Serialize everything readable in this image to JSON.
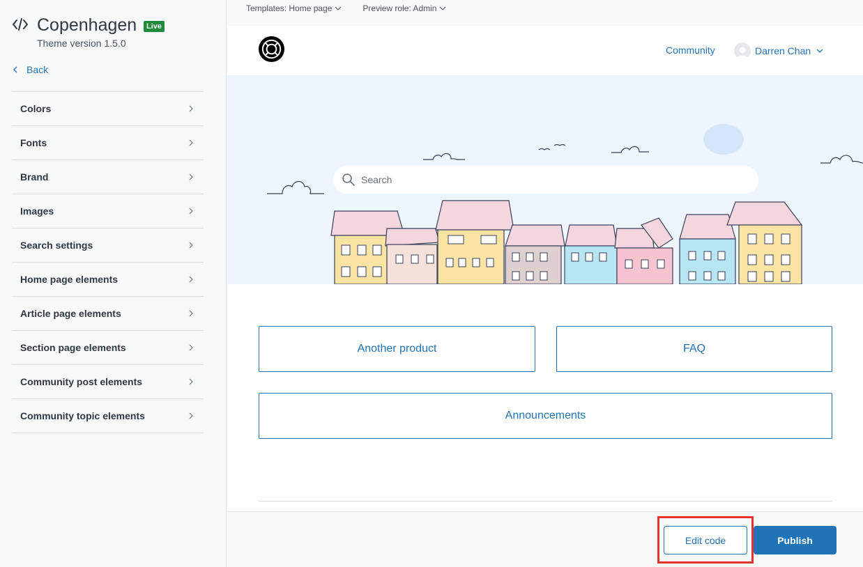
{
  "sidebar": {
    "theme_title": "Copenhagen",
    "live_badge": "Live",
    "theme_version": "Theme version 1.5.0",
    "back_label": "Back",
    "items": [
      {
        "label": "Colors"
      },
      {
        "label": "Fonts"
      },
      {
        "label": "Brand"
      },
      {
        "label": "Images"
      },
      {
        "label": "Search settings"
      },
      {
        "label": "Home page elements"
      },
      {
        "label": "Article page elements"
      },
      {
        "label": "Section page elements"
      },
      {
        "label": "Community post elements"
      },
      {
        "label": "Community topic elements"
      }
    ]
  },
  "topbar": {
    "templates_label": "Templates: Home page",
    "preview_role_label": "Preview role: Admin"
  },
  "preview": {
    "community_link": "Community",
    "user_name": "Darren Chan",
    "search_placeholder": "Search",
    "categories": [
      {
        "label": "Another product"
      },
      {
        "label": "FAQ"
      },
      {
        "label": "Announcements"
      }
    ]
  },
  "footer": {
    "edit_code_label": "Edit code",
    "publish_label": "Publish"
  },
  "colors": {
    "accent": "#1f73b7",
    "live_badge": "#1f8b3b",
    "highlight": "#e8322b"
  }
}
